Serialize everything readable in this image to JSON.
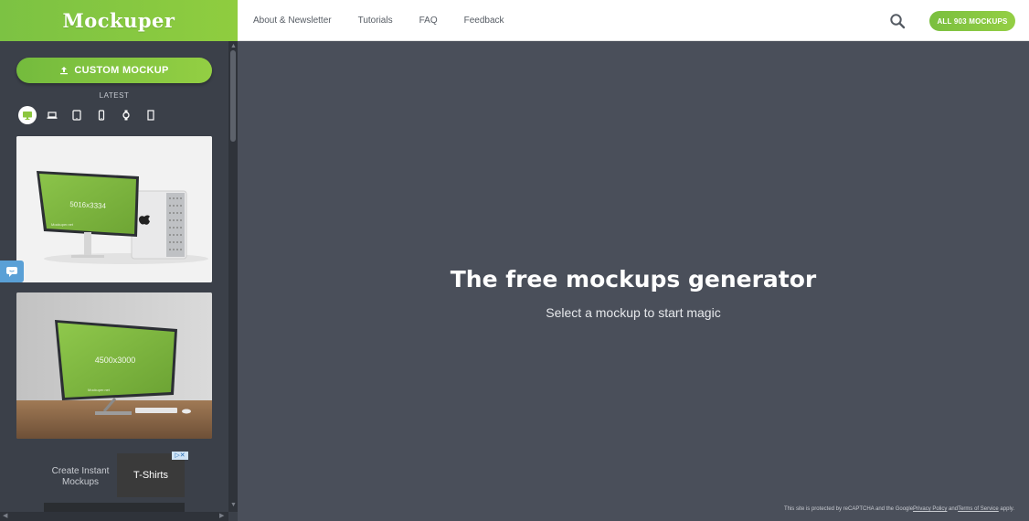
{
  "brand": {
    "name": "Mockuper"
  },
  "header": {
    "nav": [
      "About & Newsletter",
      "Tutorials",
      "FAQ",
      "Feedback"
    ],
    "search_icon": "search-icon",
    "all_mockups_label": "ALL 903 MOCKUPS"
  },
  "sidebar": {
    "custom_mockup_label": "CUSTOM MOCKUP",
    "latest_label": "LATEST",
    "device_filters": [
      "desktop-icon",
      "laptop-icon",
      "tablet-icon",
      "phone-icon",
      "watch-icon",
      "phone-portrait-icon"
    ],
    "thumbnails": [
      {
        "resolution": "5016x3334",
        "watermark": "Mockuper.net"
      },
      {
        "resolution": "4500x3000",
        "watermark": "Mockuper.net"
      }
    ],
    "ad": {
      "text": "Create Instant Mockups",
      "image_text": "T-Shirts"
    }
  },
  "main": {
    "title": "The free mockups generator",
    "subtitle": "Select a mockup to start magic",
    "recaptcha": {
      "prefix": "This site is protected by reCAPTCHA and the Google",
      "privacy": "Privacy Policy",
      "and": " and",
      "terms": "Terms of Service",
      "suffix": " apply."
    }
  },
  "colors": {
    "accent": "#8cc63f",
    "sidebar_bg": "#3b4049",
    "main_bg": "#4a4f5a"
  }
}
